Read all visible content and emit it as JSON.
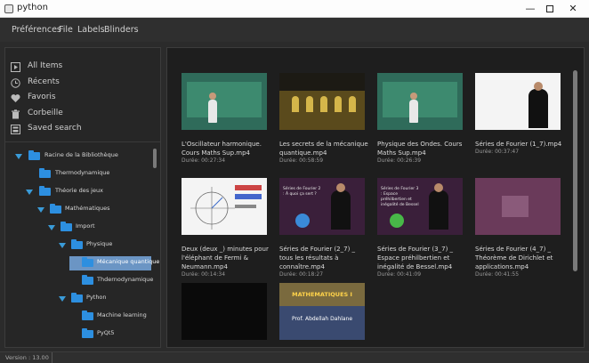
{
  "window": {
    "title": "python"
  },
  "menu": [
    "Préférences",
    "File",
    "Labels",
    "Blinders"
  ],
  "nav": [
    {
      "label": "All Items",
      "icon": "play-icon"
    },
    {
      "label": "Récents",
      "icon": "clock-icon"
    },
    {
      "label": "Favoris",
      "icon": "heart-icon"
    },
    {
      "label": "Corbeille",
      "icon": "trash-icon"
    },
    {
      "label": "Saved search",
      "icon": "saved-search-icon"
    }
  ],
  "tree": [
    {
      "label": "Racine de la Bibliothèque",
      "expanded": true
    },
    {
      "label": "Thermodynamique",
      "expanded": false
    },
    {
      "label": "Théorie des jeux",
      "expanded": true
    },
    {
      "label": "Mathématiques",
      "expanded": true
    },
    {
      "label": "Import",
      "expanded": true
    },
    {
      "label": "Physique",
      "expanded": true
    },
    {
      "label": "Mécanique quantique",
      "expanded": false,
      "selected": true
    },
    {
      "label": "Thdernodynamique",
      "expanded": false
    },
    {
      "label": "Python",
      "expanded": true
    },
    {
      "label": "Machine learning",
      "expanded": false
    },
    {
      "label": "PyQt5",
      "expanded": false
    }
  ],
  "videos": [
    {
      "title": "L'Oscillateur harmonique. Cours Maths Sup.mp4",
      "duration": "Durée: 00:27:34"
    },
    {
      "title": "Les secrets de la mécanique quantique.mp4",
      "duration": "Durée: 00:58:59"
    },
    {
      "title": "Physique des Ondes. Cours Maths Sup.mp4",
      "duration": "Durée: 00:26:39"
    },
    {
      "title": "Séries de Fourier (1_7).mp4",
      "duration": "Durée: 00:37:47"
    },
    {
      "title": "Deux (deux _) minutes pour l'éléphant de Fermi & Neumann.mp4",
      "duration": "Durée: 00:14:34"
    },
    {
      "title": "Séries de Fourier (2_7) _ tous les résultats à connaître.mp4",
      "duration": "Durée: 00:18:27"
    },
    {
      "title": "Séries de Fourier (3_7) _ Espace préhilbertien et inégalité de Bessel.mp4",
      "duration": "Durée: 00:41:09"
    },
    {
      "title": "Séries de Fourier (4_7) _ Théorème de Dirichlet et applications.mp4",
      "duration": "Durée: 00:41:55"
    },
    {
      "title": "",
      "duration": ""
    },
    {
      "title": "",
      "duration": ""
    }
  ],
  "thumb_text": {
    "math_title": "MATHEMATIQUES I",
    "math_author": "Prof. Abdellah Dahlane",
    "fourier_2": "Séries de Fourier 2 : À quoi ça sert ?",
    "fourier_3": "Séries de Fourier 3 : Espace préhilbertien et inégalité de Bessel"
  },
  "status": {
    "version": "Version : 13.00"
  },
  "colors": {
    "accent": "#2d8fe0",
    "selection": "#6b95c4",
    "background": "#2b2b2b"
  }
}
